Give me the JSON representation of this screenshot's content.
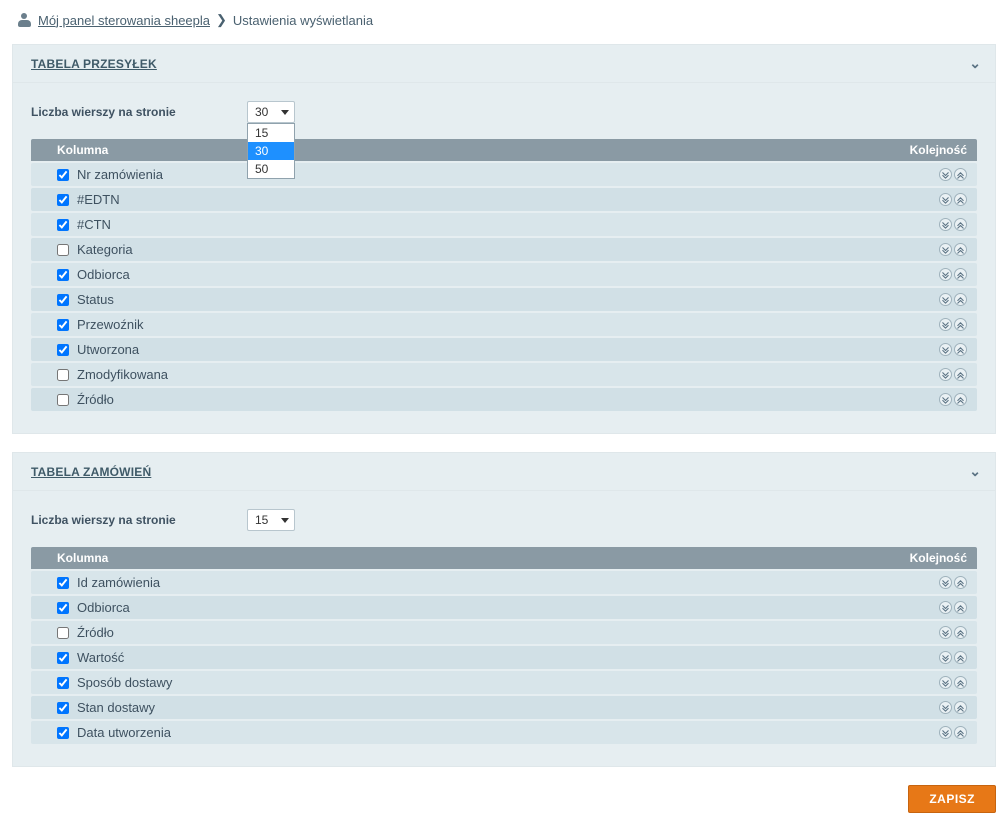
{
  "breadcrumb": {
    "home": "Mój panel sterowania sheepla",
    "current": "Ustawienia wyświetlania"
  },
  "panels": [
    {
      "title": "TABELA PRZESYŁEK",
      "rowsLabel": "Liczba wierszy na stronie",
      "rowsValue": "30",
      "rowsOptions": [
        "15",
        "30",
        "50"
      ],
      "rowsOpen": true,
      "headers": {
        "col": "Kolumna",
        "ord": "Kolejność"
      },
      "columns": [
        {
          "label": "Nr zamówienia",
          "checked": true
        },
        {
          "label": "#EDTN",
          "checked": true
        },
        {
          "label": "#CTN",
          "checked": true
        },
        {
          "label": "Kategoria",
          "checked": false
        },
        {
          "label": "Odbiorca",
          "checked": true
        },
        {
          "label": "Status",
          "checked": true
        },
        {
          "label": "Przewoźnik",
          "checked": true
        },
        {
          "label": "Utworzona",
          "checked": true
        },
        {
          "label": "Zmodyfikowana",
          "checked": false
        },
        {
          "label": "Źródło",
          "checked": false
        }
      ]
    },
    {
      "title": "TABELA ZAMÓWIEŃ",
      "rowsLabel": "Liczba wierszy na stronie",
      "rowsValue": "15",
      "rowsOptions": [
        "15",
        "30",
        "50"
      ],
      "rowsOpen": false,
      "headers": {
        "col": "Kolumna",
        "ord": "Kolejność"
      },
      "columns": [
        {
          "label": "Id zamówienia",
          "checked": true
        },
        {
          "label": "Odbiorca",
          "checked": true
        },
        {
          "label": "Źródło",
          "checked": false
        },
        {
          "label": "Wartość",
          "checked": true
        },
        {
          "label": "Sposób dostawy",
          "checked": true
        },
        {
          "label": "Stan dostawy",
          "checked": true
        },
        {
          "label": "Data utworzenia",
          "checked": true
        }
      ]
    }
  ],
  "save": "ZAPISZ"
}
